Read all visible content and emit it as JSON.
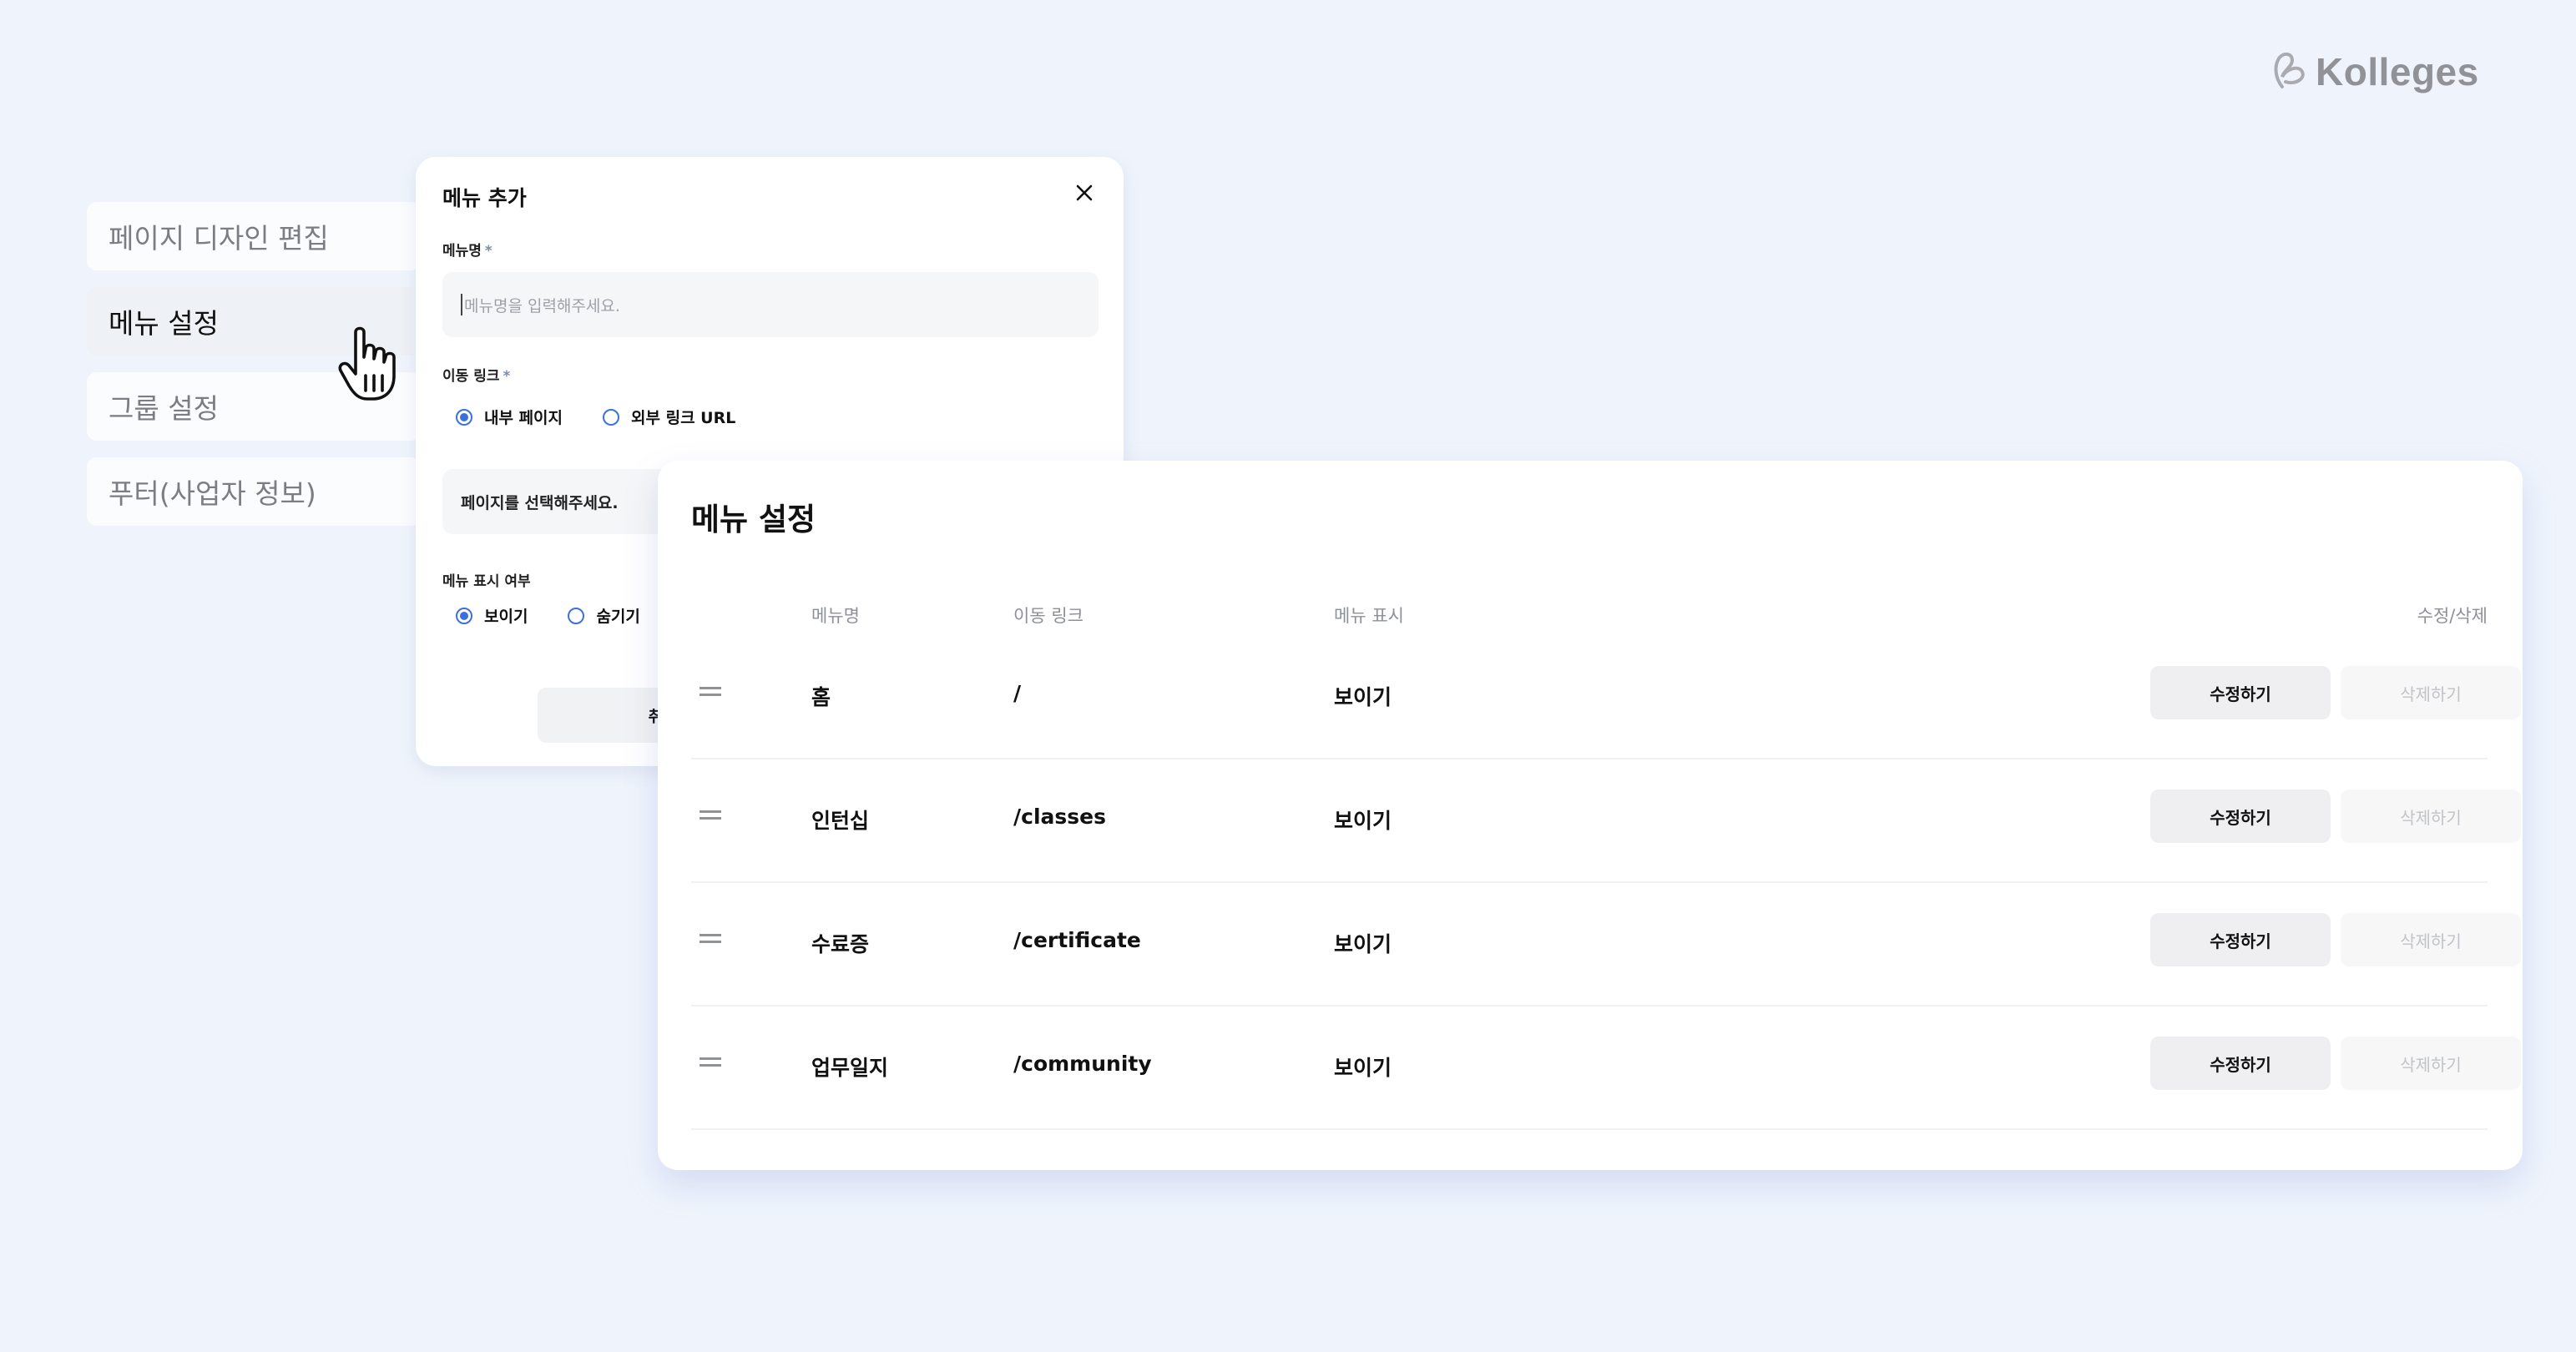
{
  "brand": {
    "name": "Kolleges",
    "logo_icon": "kolleges-logo-icon",
    "color": "#909297"
  },
  "sidebar": {
    "items": [
      {
        "label": "페이지 디자인 편집",
        "active": false
      },
      {
        "label": "메뉴 설정",
        "active": true
      },
      {
        "label": "그룹 설정",
        "active": false
      },
      {
        "label": "푸터(사업자 정보)",
        "active": false
      }
    ]
  },
  "cursor": {
    "icon": "hand-pointer-icon"
  },
  "modal": {
    "title": "메뉴 추가",
    "close_icon": "close-icon",
    "name_field": {
      "label": "메뉴명",
      "required_mark": "*",
      "placeholder": "메뉴명을 입력해주세요.",
      "value": ""
    },
    "link_field": {
      "label": "이동 링크",
      "required_mark": "*",
      "options": [
        {
          "label": "내부 페이지",
          "selected": true
        },
        {
          "label": "외부 링크 URL",
          "selected": false
        }
      ],
      "page_select_placeholder": "페이지를 선택해주세요."
    },
    "visibility_field": {
      "label": "메뉴 표시 여부",
      "options": [
        {
          "label": "보이기",
          "selected": true
        },
        {
          "label": "숨기기",
          "selected": false
        }
      ]
    },
    "cancel_label": "취소"
  },
  "menu_panel": {
    "title": "메뉴 설정",
    "columns": {
      "name": "메뉴명",
      "link": "이동 링크",
      "display": "메뉴 표시",
      "actions": "수정/삭제"
    },
    "rows": [
      {
        "name": "홈",
        "link": "/",
        "display": "보이기"
      },
      {
        "name": "인턴십",
        "link": "/classes",
        "display": "보이기"
      },
      {
        "name": "수료증",
        "link": "/certificate",
        "display": "보이기"
      },
      {
        "name": "업무일지",
        "link": "/community",
        "display": "보이기"
      }
    ],
    "edit_label": "수정하기",
    "delete_label": "삭제하기",
    "drag_icon": "drag-handle-icon"
  },
  "colors": {
    "background": "#eff4fc",
    "accent": "#3b70dd"
  }
}
